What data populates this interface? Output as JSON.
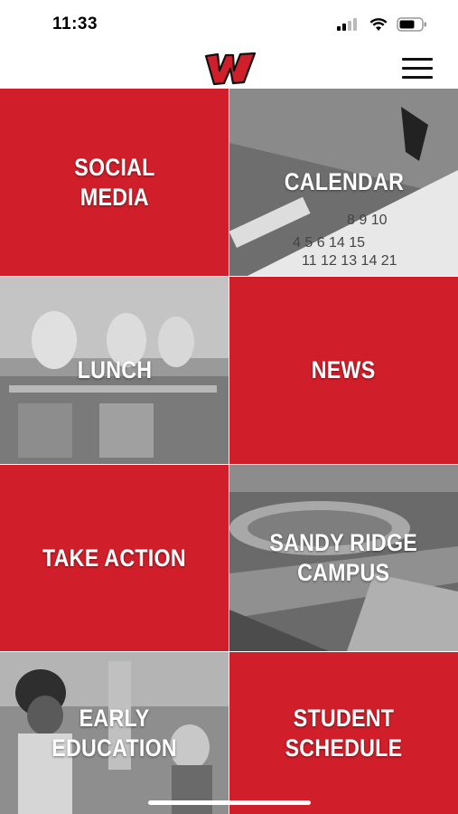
{
  "status_bar": {
    "time": "11:33",
    "icons": [
      "cellular-signal-icon",
      "wifi-icon",
      "battery-icon"
    ]
  },
  "header": {
    "logo": "w-logo",
    "menu_icon": "hamburger-menu-icon"
  },
  "colors": {
    "brand_red": "#d01f2a",
    "photo_gray": "#777777"
  },
  "tiles": [
    {
      "label": "SOCIAL\nMEDIA",
      "style": "red"
    },
    {
      "label": "CALENDAR",
      "style": "photo"
    },
    {
      "label": "LUNCH",
      "style": "photo"
    },
    {
      "label": "NEWS",
      "style": "red"
    },
    {
      "label": "TAKE ACTION",
      "style": "red"
    },
    {
      "label": "SANDY RIDGE\nCAMPUS",
      "style": "photo"
    },
    {
      "label": "EARLY\nEDUCATION",
      "style": "photo"
    },
    {
      "label": "STUDENT\nSCHEDULE",
      "style": "red"
    }
  ]
}
